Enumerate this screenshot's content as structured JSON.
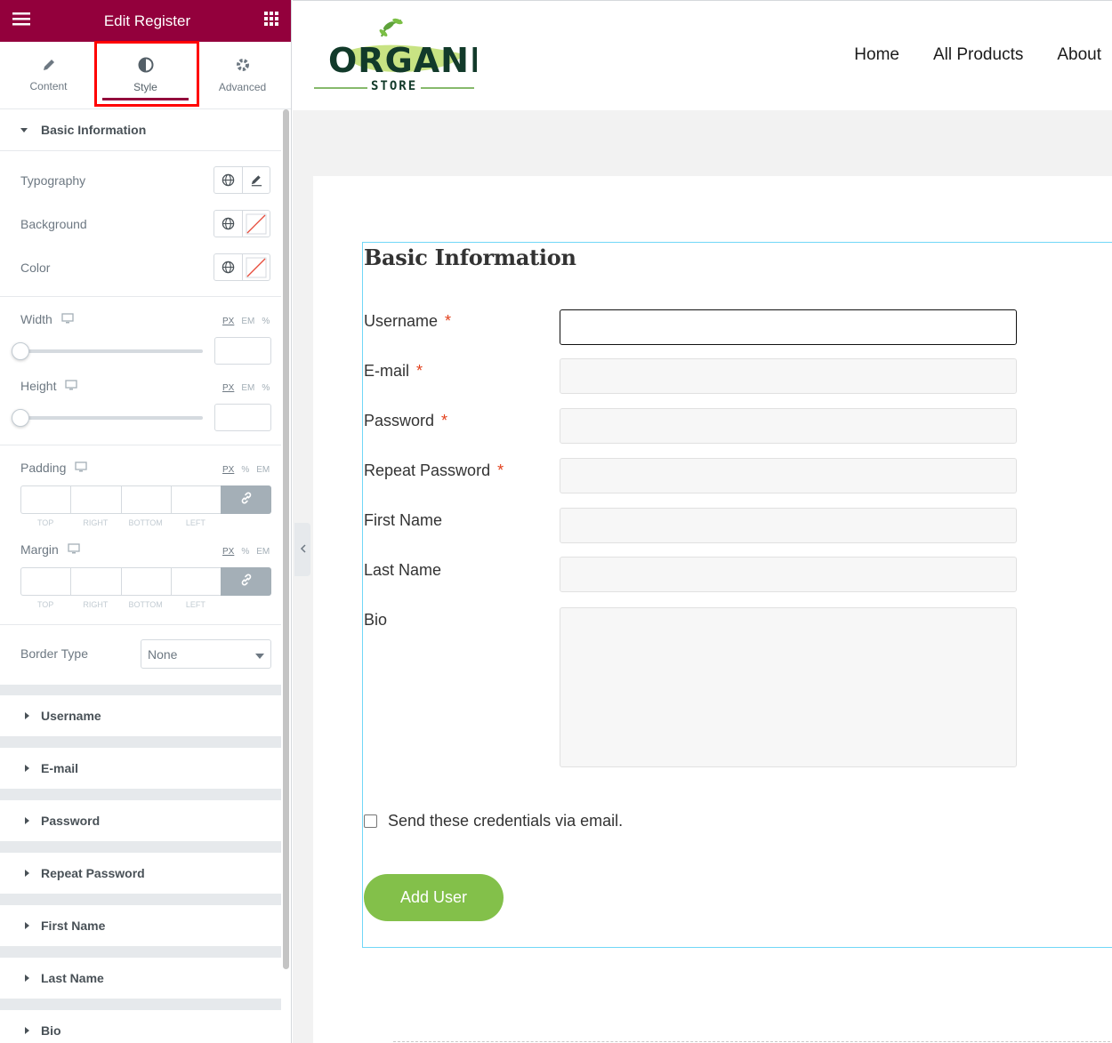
{
  "panel": {
    "title": "Edit Register",
    "tabs": [
      {
        "label": "Content",
        "icon": "pencil-icon"
      },
      {
        "label": "Style",
        "icon": "contrast-icon"
      },
      {
        "label": "Advanced",
        "icon": "gear-icon"
      }
    ],
    "active_tab": "Style",
    "section_open": "Basic Information",
    "controls": {
      "typography": "Typography",
      "background": "Background",
      "color": "Color",
      "width": "Width",
      "height": "Height",
      "padding": "Padding",
      "margin": "Margin",
      "border_type": "Border Type",
      "border_type_value": "None",
      "units_px_em_pct": [
        "PX",
        "EM",
        "%"
      ],
      "units_px_pct_em": [
        "PX",
        "%",
        "EM"
      ],
      "dim_labels": [
        "TOP",
        "RIGHT",
        "BOTTOM",
        "LEFT"
      ]
    },
    "collapsed_sections": [
      "Username",
      "E-mail",
      "Password",
      "Repeat Password",
      "First Name",
      "Last Name",
      "Bio"
    ]
  },
  "site": {
    "logo_main": "ORGANIC",
    "logo_sub": "STORE",
    "nav": [
      "Home",
      "All Products",
      "About"
    ]
  },
  "form": {
    "title": "Basic Information",
    "fields": [
      {
        "label": "Username",
        "required": true
      },
      {
        "label": "E-mail",
        "required": true
      },
      {
        "label": "Password",
        "required": true
      },
      {
        "label": "Repeat Password",
        "required": true
      },
      {
        "label": "First Name",
        "required": false
      },
      {
        "label": "Last Name",
        "required": false
      },
      {
        "label": "Bio",
        "required": false
      }
    ],
    "required_mark": "*",
    "checkbox_label": "Send these credentials via email.",
    "submit_label": "Add User"
  },
  "colors": {
    "panel_header": "#93003c",
    "highlight": "#ff0000",
    "submit": "#83c04a",
    "form_outline": "#71d7f7"
  }
}
